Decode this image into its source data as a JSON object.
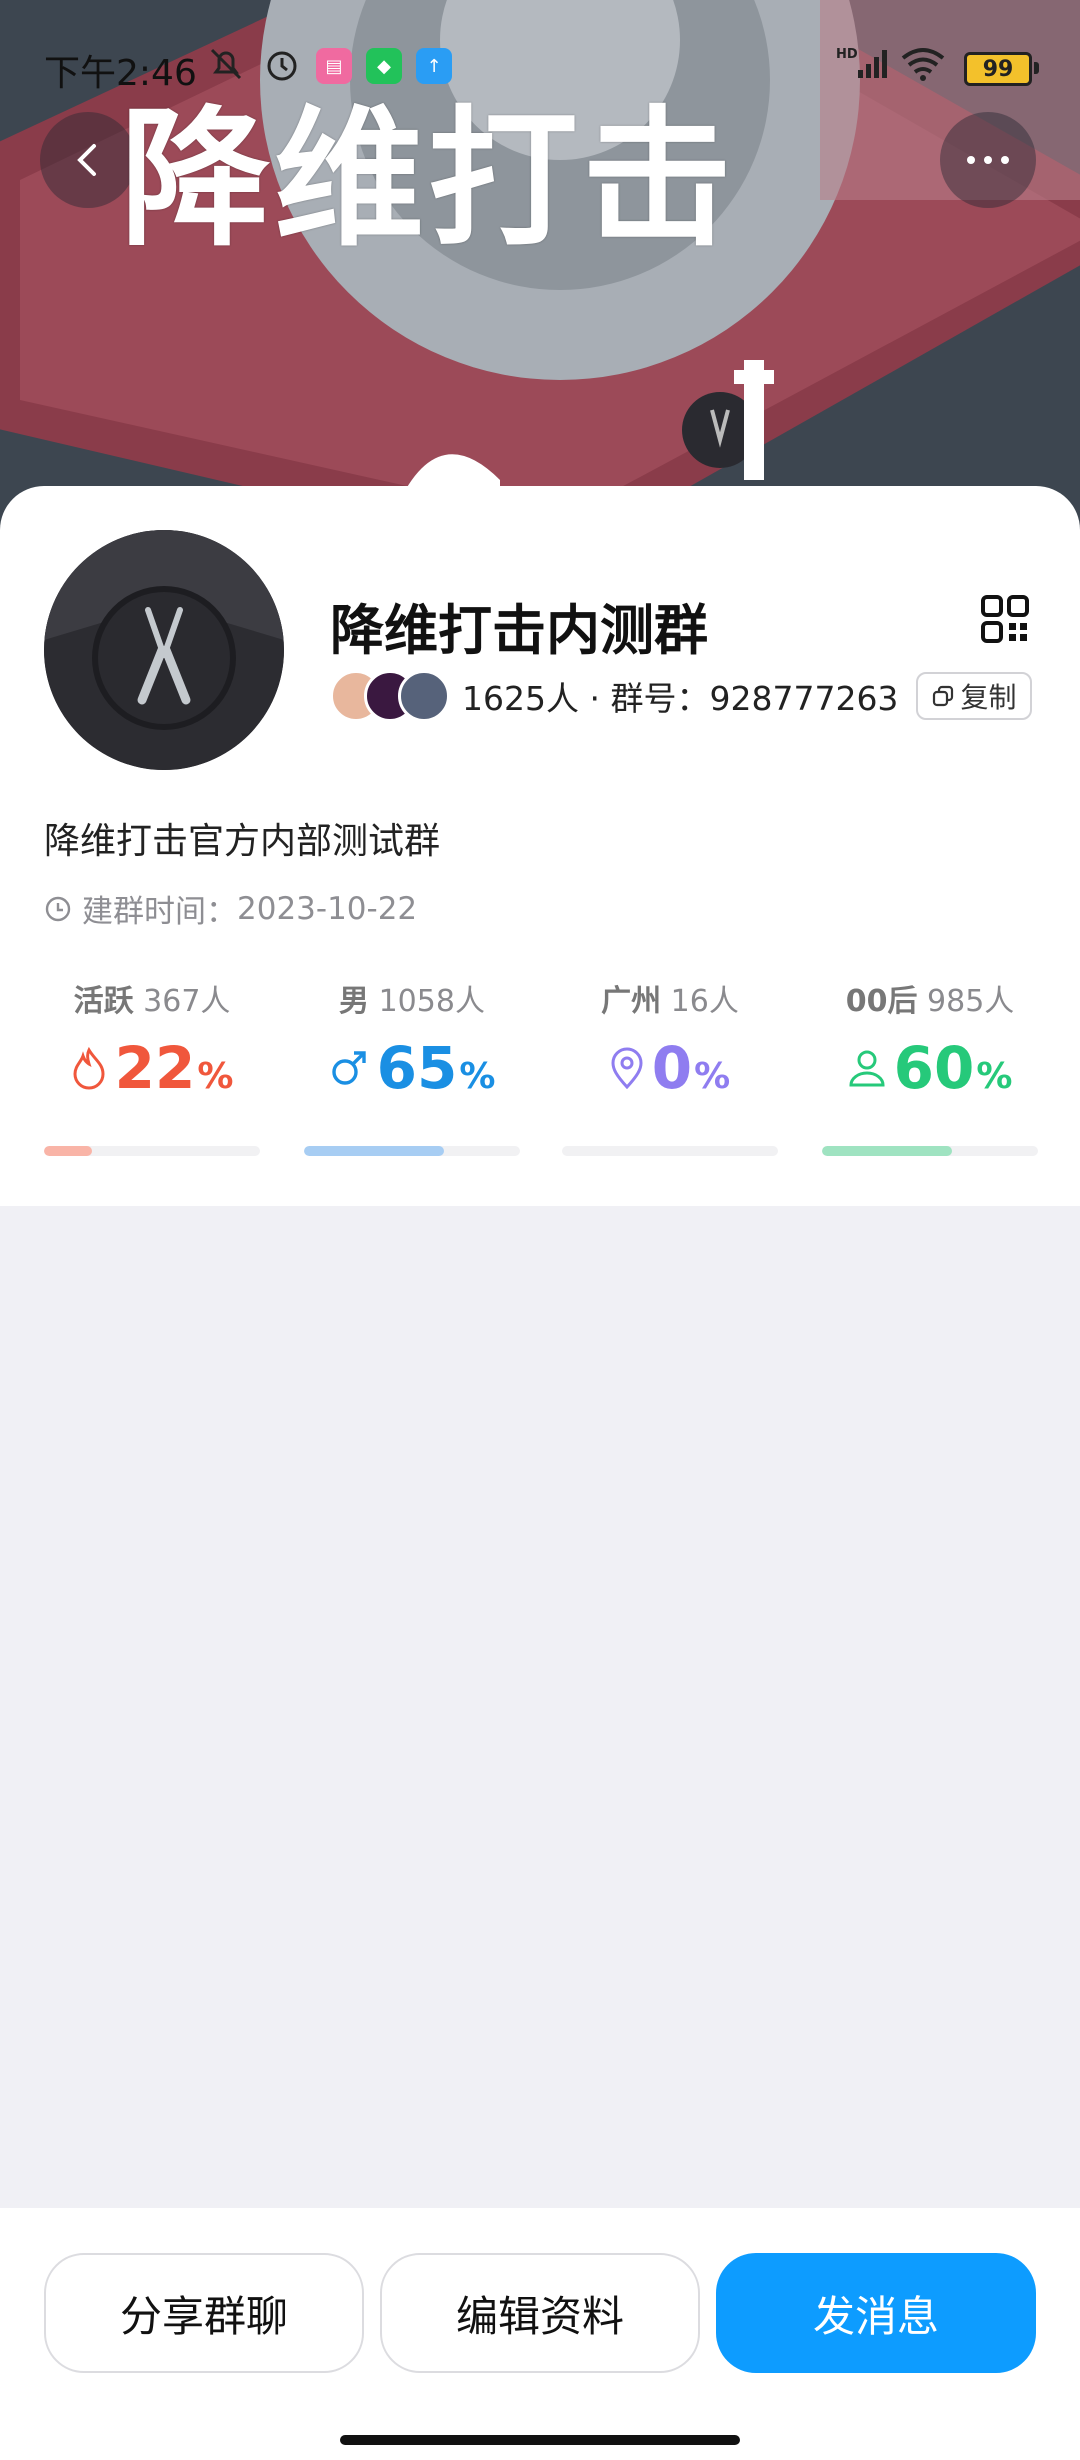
{
  "status_bar": {
    "time": "下午2:46",
    "battery": "99"
  },
  "hero": {
    "title": "降维打击"
  },
  "group": {
    "name": "降维打击内测群",
    "member_count": "1625人",
    "separator": " · ",
    "group_id_label": "群号：",
    "group_id": "928777263",
    "copy_label": "复制",
    "description": "降维打击官方内部测试群",
    "created_label": "建群时间：",
    "created_date": "2023-10-22"
  },
  "stats": [
    {
      "label": "活跃",
      "count": "367人",
      "value": "22",
      "unit": "%",
      "fraction": 0.22,
      "color": "#f0573c",
      "bar_color": "#f9b4a7",
      "icon": "flame-icon"
    },
    {
      "label": "男",
      "count": "1058人",
      "value": "65",
      "unit": "%",
      "fraction": 0.65,
      "color": "#1a8fe3",
      "bar_color": "#a7cdf3",
      "icon": "male-icon"
    },
    {
      "label": "广州",
      "count": "16人",
      "value": "0",
      "unit": "%",
      "fraction": 0.0,
      "color": "#8f7df0",
      "bar_color": "#c9c0f7",
      "icon": "location-pin-icon"
    },
    {
      "label": "00后",
      "count": "985人",
      "value": "60",
      "unit": "%",
      "fraction": 0.6,
      "color": "#26c97a",
      "bar_color": "#9fe3c1",
      "icon": "person-icon"
    }
  ],
  "actions": {
    "share": "分享群聊",
    "edit": "编辑资料",
    "send": "发消息"
  },
  "colors": {
    "primary": "#0d9cff"
  }
}
